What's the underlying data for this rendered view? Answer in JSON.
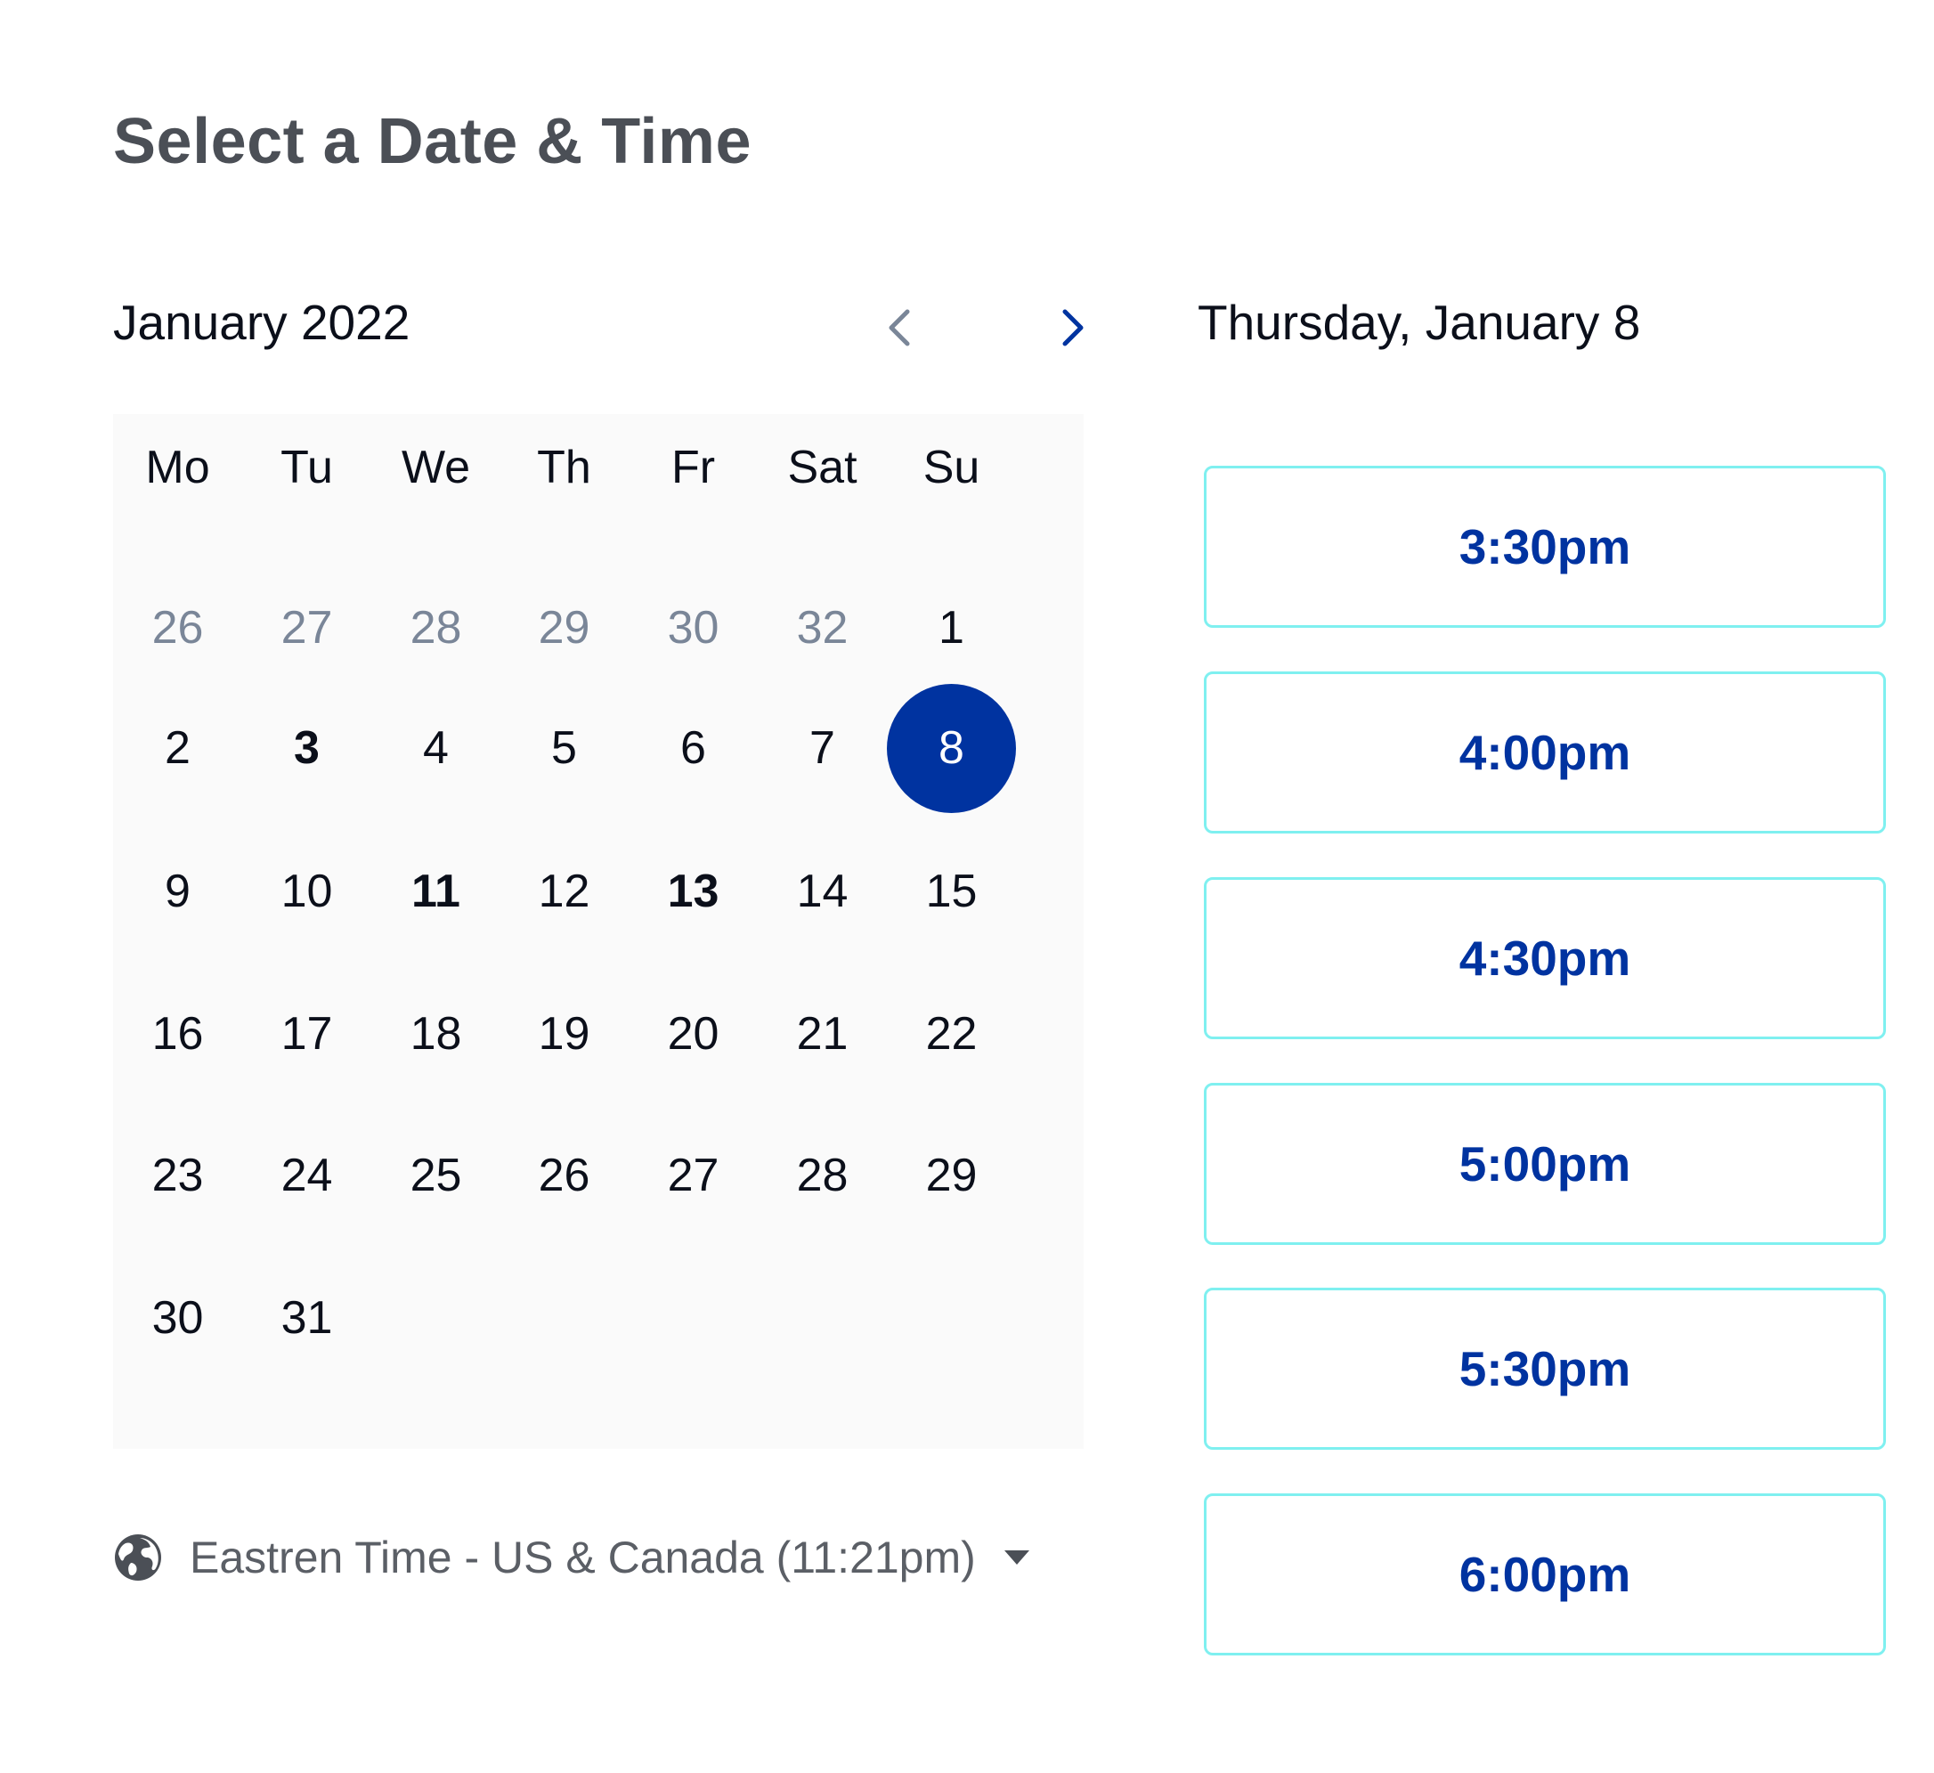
{
  "header": {
    "title": "Select a Date & Time"
  },
  "calendar": {
    "month_label": "January 2022",
    "weekdays": [
      "Mo",
      "Tu",
      "We",
      "Th",
      "Fr",
      "Sat",
      "Su"
    ],
    "rows": [
      [
        "26",
        "27",
        "28",
        "29",
        "30",
        "32",
        "1"
      ],
      [
        "2",
        "3",
        "4",
        "5",
        "6",
        "7",
        "8"
      ],
      [
        "9",
        "10",
        "11",
        "12",
        "13",
        "14",
        "15"
      ],
      [
        "16",
        "17",
        "18",
        "19",
        "20",
        "21",
        "22"
      ],
      [
        "23",
        "24",
        "25",
        "26",
        "27",
        "28",
        "29"
      ],
      [
        "30",
        "31",
        "",
        "",
        "",
        "",
        ""
      ]
    ],
    "muted_count_first_row": 6,
    "bold_days": [
      "3",
      "11",
      "13"
    ],
    "selected_day": "8",
    "accent_color": "#0033a0"
  },
  "timezone": {
    "label": "Eastren Time - US & Canada (11:21pm)",
    "icon": "globe-icon"
  },
  "schedule": {
    "day_heading": "Thursday, January 8",
    "slots": [
      "3:30pm",
      "4:00pm",
      "4:30pm",
      "5:00pm",
      "5:30pm",
      "6:00pm"
    ],
    "slot_border_color": "#7ff0f0"
  }
}
